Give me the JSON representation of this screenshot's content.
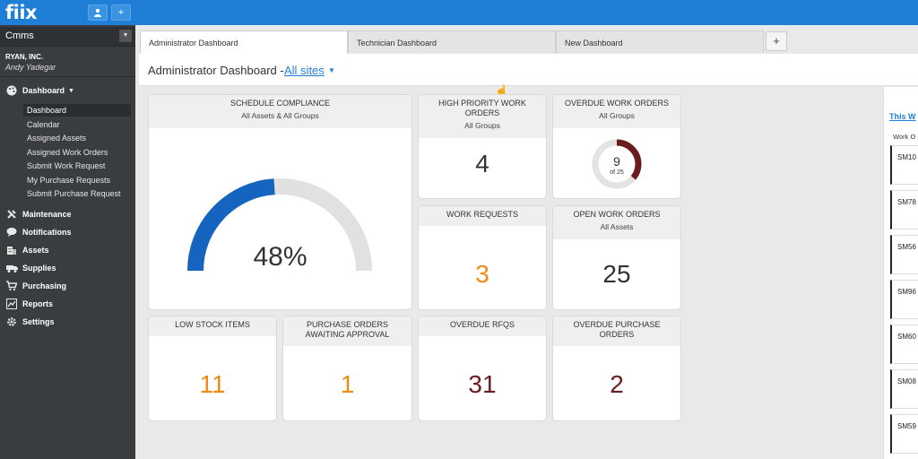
{
  "app": {
    "logo": "fiix"
  },
  "topbar": {
    "user_icon": "person-icon",
    "add_label": "+"
  },
  "sidebar": {
    "module": "Cmms",
    "company": "RYAN, INC.",
    "user": "Andy Yadegar",
    "dashboard_label": "Dashboard",
    "dashboard_items": [
      "Dashboard",
      "Calendar",
      "Assigned Assets",
      "Assigned Work Orders",
      "Submit Work Request",
      "My Purchase Requests",
      "Submit Purchase Request"
    ],
    "sections": [
      {
        "label": "Maintenance",
        "icon": "wrench-icon"
      },
      {
        "label": "Notifications",
        "icon": "chat-icon"
      },
      {
        "label": "Assets",
        "icon": "building-icon"
      },
      {
        "label": "Supplies",
        "icon": "truck-icon"
      },
      {
        "label": "Purchasing",
        "icon": "cart-icon"
      },
      {
        "label": "Reports",
        "icon": "chart-icon"
      },
      {
        "label": "Settings",
        "icon": "gear-icon"
      }
    ]
  },
  "tabs": [
    "Administrator Dashboard",
    "Technician Dashboard",
    "New Dashboard"
  ],
  "tab_add_label": "+",
  "header": {
    "title": "Administrator Dashboard -",
    "site": "All sites"
  },
  "widgets": {
    "schedule_compliance": {
      "title": "SCHEDULE COMPLIANCE",
      "subtitle": "All Assets & All Groups",
      "percent_label": "48%",
      "percent": 48
    },
    "high_priority": {
      "title_line1": "HIGH PRIORITY WORK",
      "title_line2": "ORDERS",
      "subtitle": "All Groups",
      "value": "4"
    },
    "overdue_wo": {
      "title": "OVERDUE WORK ORDERS",
      "subtitle": "All Groups",
      "value": "9",
      "of_label": "of 25",
      "fraction": 0.36
    },
    "work_requests": {
      "title": "WORK REQUESTS",
      "value": "3"
    },
    "open_wo": {
      "title": "OPEN WORK ORDERS",
      "subtitle": "All Assets",
      "value": "25"
    },
    "low_stock": {
      "title": "LOW STOCK ITEMS",
      "value": "11"
    },
    "po_approval": {
      "title_line1": "PURCHASE ORDERS",
      "title_line2": "AWAITING APPROVAL",
      "value": "1"
    },
    "overdue_rfqs": {
      "title": "OVERDUE RFQS",
      "value": "31"
    },
    "overdue_po": {
      "title_line1": "OVERDUE PURCHASE",
      "title_line2": "ORDERS",
      "value": "2"
    }
  },
  "right_panel": {
    "link": "This W",
    "column": "Work O",
    "items": [
      "SM10",
      "SM78",
      "SM56",
      "SM96",
      "SM60",
      "SM08",
      "SM59"
    ]
  },
  "colors": {
    "accent": "#1f7fd6",
    "gauge": "#1565c0",
    "orange": "#ef8a16",
    "maroon": "#6b1d1d",
    "dark": "#333333"
  }
}
